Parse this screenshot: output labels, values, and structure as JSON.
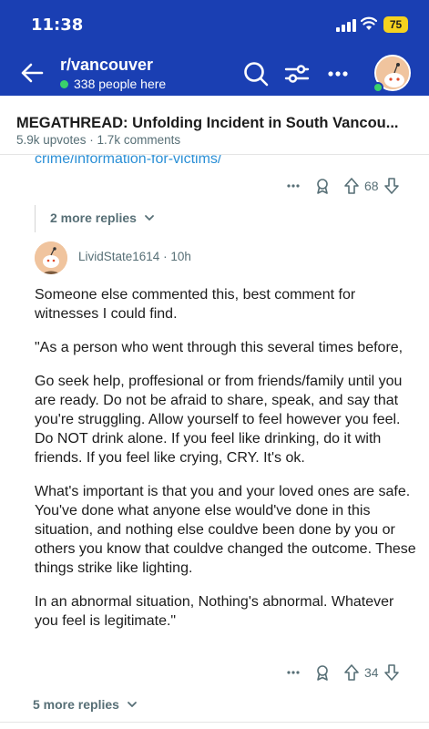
{
  "status_bar": {
    "time": "11:38",
    "battery": "75"
  },
  "header": {
    "subreddit": "r/vancouver",
    "online_text": "338 people here",
    "icons": [
      "back-arrow-icon",
      "search-icon",
      "filter-icon",
      "more-icon",
      "avatar"
    ]
  },
  "post": {
    "title": "MEGATHREAD: Unfolding Incident in South Vancou...",
    "meta": "5.9k upvotes · 1.7k comments"
  },
  "prev_comment": {
    "cut_text": "crime/information-for-victims/",
    "votes": "68",
    "more_replies": "2 more replies"
  },
  "comment": {
    "author": "LividState1614",
    "age": "10h",
    "paragraphs": [
      "Someone else commented this, best comment for witnesses I could find.",
      "\"As a person who went through this several times before,",
      "Go seek help, proffesional or from friends/family until you are ready. Do not be afraid to share, speak, and say that you're struggling. Allow yourself to feel however you feel. Do NOT drink alone. If you feel like drinking, do it with friends. If you feel like crying, CRY. It's ok.",
      "What's important is that you and your loved ones are safe. You've done what anyone else would've done in this situation, and nothing else couldve been done by you or others you know that couldve changed the outcome. These things strike like lighting.",
      "In an abnormal situation, Nothing's abnormal. Whatever you feel is legitimate.\""
    ],
    "votes": "34",
    "more_replies": "5 more replies"
  },
  "colors": {
    "header_bg": "#1a3fb3",
    "online_dot": "#3ad16b",
    "meta_text": "#576f76",
    "link": "#2a8fd6"
  }
}
